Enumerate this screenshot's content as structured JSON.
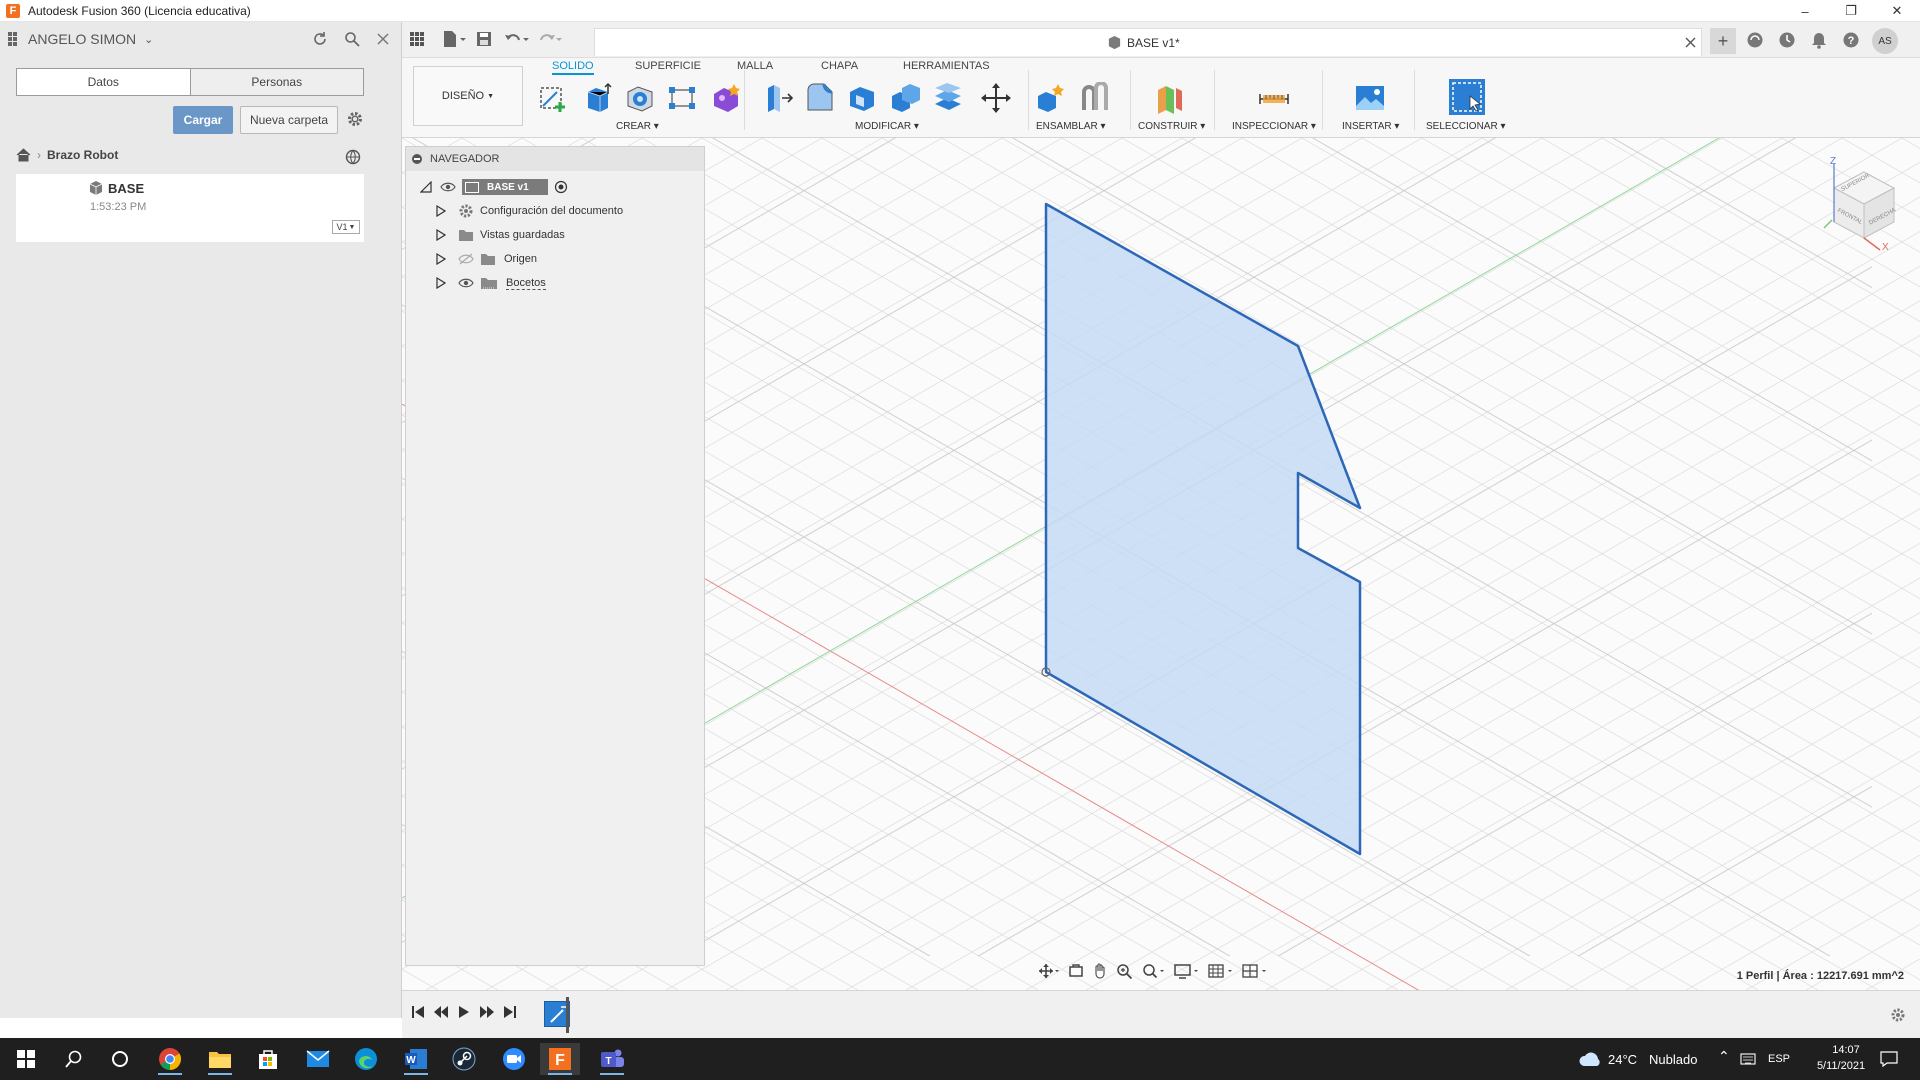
{
  "window": {
    "title": "Autodesk Fusion 360 (Licencia educativa)",
    "logo_letter": "F"
  },
  "data_panel": {
    "user": "ANGELO SIMON",
    "tabs": [
      "Datos",
      "Personas"
    ],
    "upload_label": "Cargar",
    "new_folder_label": "Nueva carpeta",
    "breadcrumb": "Brazo Robot",
    "file": {
      "name": "BASE",
      "time": "1:53:23 PM",
      "version": "V1"
    }
  },
  "document": {
    "tab_title": "BASE v1*",
    "user_initials": "AS"
  },
  "ribbon": {
    "workspace": "DISEÑO",
    "tabs": [
      "SOLIDO",
      "SUPERFICIE",
      "MALLA",
      "CHAPA",
      "HERRAMIENTAS"
    ],
    "active_tab": "SOLIDO",
    "groups": [
      "CREAR",
      "MODIFICAR",
      "ENSAMBLAR",
      "CONSTRUIR",
      "INSPECCIONAR",
      "INSERTAR",
      "SELECCIONAR"
    ]
  },
  "navigator": {
    "title": "NAVEGADOR",
    "root": "BASE v1",
    "items": [
      "Configuración del documento",
      "Vistas guardadas",
      "Origen",
      "Bocetos"
    ]
  },
  "viewcube": {
    "faces": [
      "SUPERIOR",
      "FRONTAL",
      "DERECHA"
    ],
    "axes": [
      "Z",
      "X"
    ]
  },
  "status": {
    "selection_info": "1 Perfil | Área : 12217.691 mm^2"
  },
  "taskbar": {
    "weather_temp": "24°C",
    "weather_text": "Nublado",
    "language": "ESP",
    "time": "14:07",
    "date": "5/11/2021"
  },
  "colors": {
    "accent": "#0696d7",
    "profile_fill": "#c5dbf5",
    "profile_stroke": "#2d68b8",
    "upload_button": "#6a96c8"
  }
}
